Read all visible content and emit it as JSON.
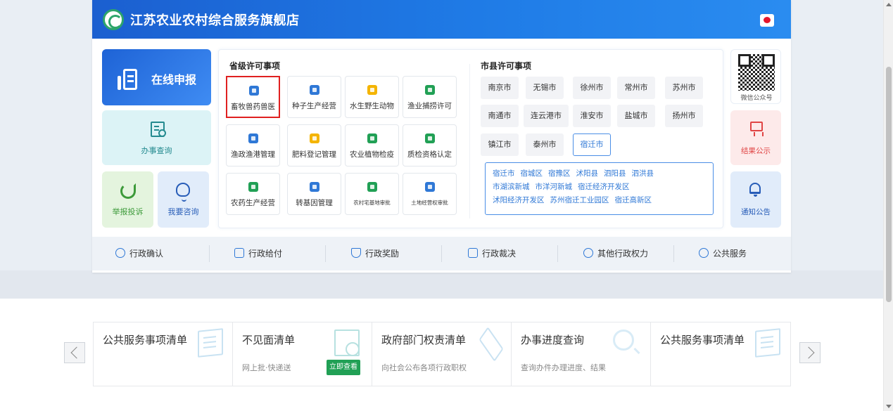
{
  "header": {
    "title": "江苏农业农村综合服务旗舰店"
  },
  "left": {
    "apply": "在线申报",
    "query": "办事查询",
    "report": "举报投诉",
    "consult": "我要咨询"
  },
  "province": {
    "title": "省级许可事项",
    "items": [
      {
        "label": "畜牧兽药兽医",
        "color": "#2f78d6",
        "selected": true
      },
      {
        "label": "种子生产经营",
        "color": "#2f78d6"
      },
      {
        "label": "水生野生动物",
        "color": "#f4b400"
      },
      {
        "label": "渔业捕捞许可",
        "color": "#21a055"
      },
      {
        "label": "渔政渔港管理",
        "color": "#2f78d6"
      },
      {
        "label": "肥料登记管理",
        "color": "#f4b400"
      },
      {
        "label": "农业植物检疫",
        "color": "#21a055"
      },
      {
        "label": "质检资格认定",
        "color": "#21a055"
      },
      {
        "label": "农药生产经营",
        "color": "#21a055"
      },
      {
        "label": "转基因管理",
        "color": "#2f78d6"
      },
      {
        "label": "农村宅基地审批",
        "color": "#21a055"
      },
      {
        "label": "土地经营权审批",
        "color": "#2f78d6"
      }
    ]
  },
  "city": {
    "title": "市县许可事项",
    "items": [
      "南京市",
      "无锡市",
      "徐州市",
      "常州市",
      "苏州市",
      "南通市",
      "连云港市",
      "淮安市",
      "盐城市",
      "扬州市",
      "镇江市",
      "泰州市",
      "宿迁市"
    ],
    "active": "宿迁市",
    "districts": [
      [
        "宿迁市",
        "宿城区",
        "宿豫区",
        "沭阳县",
        "泗阳县",
        "泗洪县"
      ],
      [
        "市湖滨新城",
        "市洋河新城",
        "宿迁经济开发区"
      ],
      [
        "沭阳经济开发区",
        "苏州宿迁工业园区",
        "宿迁高新区"
      ]
    ]
  },
  "right": {
    "qr": "微信公众号",
    "result": "结果公示",
    "notice": "通知公告"
  },
  "power_bar": [
    "行政确认",
    "行政给付",
    "行政奖励",
    "行政裁决",
    "其他行政权力",
    "公共服务"
  ],
  "lists": [
    {
      "title": "公共服务事项清单",
      "sub": "",
      "badge": ""
    },
    {
      "title": "不见面清单",
      "sub": "网上批·快递送",
      "badge": "立即查看"
    },
    {
      "title": "政府部门权责清单",
      "sub": "向社会公布各项行政职权",
      "badge": ""
    },
    {
      "title": "办事进度查询",
      "sub": "查询办件办理进度、结果",
      "badge": ""
    },
    {
      "title": "公共服务事项清单",
      "sub": "",
      "badge": ""
    }
  ],
  "colors": {
    "header_blue": "#1f7be6",
    "selected_border": "#e02020",
    "active_city": "#2f78d6",
    "badge_green": "#21a055"
  }
}
